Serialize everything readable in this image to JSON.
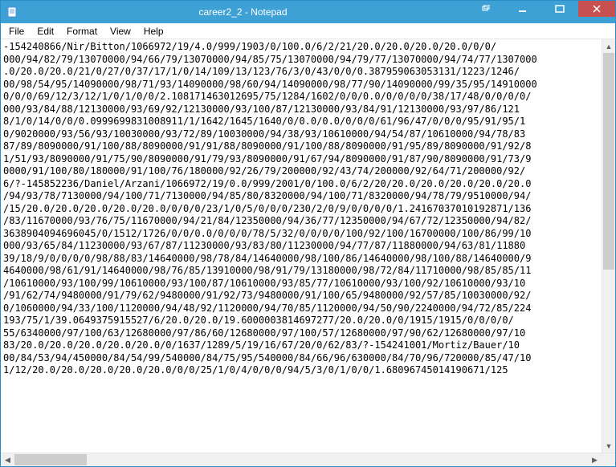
{
  "window": {
    "title": "career2_2 - Notepad"
  },
  "menu": {
    "file": "File",
    "edit": "Edit",
    "format": "Format",
    "view": "View",
    "help": "Help"
  },
  "content": {
    "lines": [
      "-154240866/Nir/Bitton/1066972/19/4.0/999/1903/0/100.0/6/2/21/20.0/20.0/20.0/20.0/0/0/",
      "000/94/82/79/13070000/94/66/79/13070000/94/85/75/13070000/94/79/77/13070000/94/74/77/1307000",
      ".0/20.0/20.0/21/0/27/0/37/17/1/0/14/109/13/123/76/3/0/43/0/0/0.387959063053131/1223/1246/",
      "00/98/54/95/14090000/98/71/93/14090000/98/60/94/14090000/98/77/90/14090000/99/35/95/14910000",
      "0/0/0/69/12/3/12/1/0/1/0/0/2.108171463012695/75/1284/1602/0/0/0.0/0/0/0/0/38/17/48/0/0/0/0/",
      "000/93/84/88/12130000/93/69/92/12130000/93/100/87/12130000/93/84/91/12130000/93/97/86/121",
      "8/1/0/14/0/0/0.0999699831008911/1/1642/1645/1640/0/0.0/0.0/0/0/0/61/96/47/0/0/0/95/91/95/1",
      "0/9020000/93/56/93/10030000/93/72/89/10030000/94/38/93/10610000/94/54/87/10610000/94/78/83",
      "87/89/8090000/91/100/88/8090000/91/91/88/8090000/91/100/88/8090000/91/95/89/8090000/91/92/8",
      "1/51/93/8090000/91/75/90/8090000/91/79/93/8090000/91/67/94/8090000/91/87/90/8090000/91/73/9",
      "0000/91/100/80/180000/91/100/76/180000/92/26/79/200000/92/43/74/200000/92/64/71/200000/92/",
      "6/?-145852236/Daniel/Arzani/1066972/19/0.0/999/2001/0/100.0/6/2/20/20.0/20.0/20.0/20.0/20.0",
      "/94/93/78/7130000/94/100/71/7130000/94/85/80/8320000/94/100/71/8320000/94/78/79/9510000/94/",
      "/15/20.0/20.0/20.0/20.0/20.0/0/0/0/23/1/0/5/0/0/0/230/2/0/9/0/0/0/0/1.24167037010192871/136",
      "/83/11670000/93/76/75/11670000/94/21/84/12350000/94/36/77/12350000/94/67/72/12350000/94/82/",
      "3638904094696045/0/1512/1726/0/0/0.0/0/0/0/78/5/32/0/0/0/0/100/92/100/16700000/100/86/99/10",
      "000/93/65/84/11230000/93/67/87/11230000/93/83/80/11230000/94/77/87/11880000/94/63/81/11880",
      "39/18/9/0/0/0/0/98/88/83/14640000/98/78/84/14640000/98/100/86/14640000/98/100/88/14640000/9",
      "4640000/98/61/91/14640000/98/76/85/13910000/98/91/79/13180000/98/72/84/11710000/98/85/85/11",
      "/10610000/93/100/99/10610000/93/100/87/10610000/93/85/77/10610000/93/100/92/10610000/93/10",
      "/91/62/74/9480000/91/79/62/9480000/91/92/73/9480000/91/100/65/9480000/92/57/85/10030000/92/",
      "0/1060000/94/33/100/1120000/94/48/92/1120000/94/70/85/1120000/94/50/90/2240000/94/72/85/224",
      "193/75/1/39.0649375915527/6/20.0/20.0/19.6000003814697277/20.0/20.0/0/1915/1915/0/0/0/0/",
      "55/6340000/97/100/63/12680000/97/86/60/12680000/97/100/57/12680000/97/90/62/12680000/97/10",
      "83/20.0/20.0/20.0/20.0/20.0/0/1637/1289/5/19/16/67/20/0/62/83/?-154241001/Mortiz/Bauer/10",
      "00/84/53/94/450000/84/54/99/540000/84/75/95/540000/84/66/96/630000/84/70/96/720000/85/47/10",
      "1/12/20.0/20.0/20.0/20.0/20.0/0/0/25/1/0/4/0/0/0/94/5/3/0/1/0/0/1.68096745014190671/125"
    ]
  },
  "scroll": {
    "v_thumb_top": 0,
    "v_thumb_height": 270,
    "h_thumb_left": 0,
    "h_thumb_width": 90
  }
}
